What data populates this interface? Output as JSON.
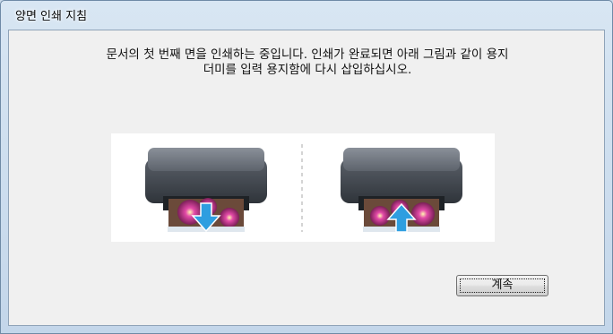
{
  "window": {
    "title": "양면 인쇄 지침"
  },
  "message": {
    "line1": "문서의 첫 번째 면을 인쇄하는 중입니다. 인쇄가 완료되면 아래 그림과 같이 용지",
    "line2": "더미를 입력 용지함에 다시 삽입하십시오."
  },
  "buttons": {
    "continue_label": "계속"
  },
  "illustration": {
    "left_arrow": "down",
    "right_arrow": "up",
    "arrow_color": "#2e9ee0",
    "printer_color": "#4f555e"
  }
}
